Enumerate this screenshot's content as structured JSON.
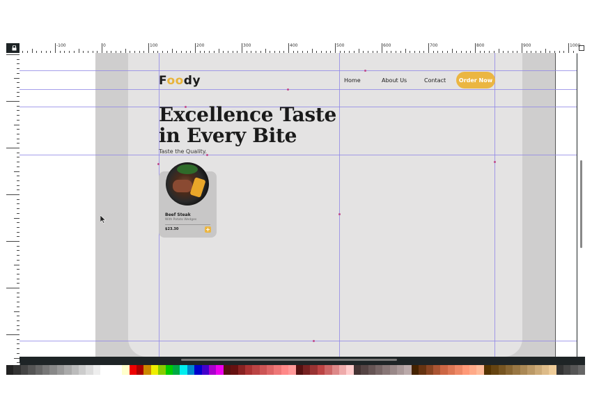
{
  "ruler": {
    "labels": [
      "-100",
      "0",
      "100",
      "200",
      "300",
      "400",
      "500",
      "600",
      "700",
      "800",
      "900",
      "1000"
    ]
  },
  "brand": {
    "logo_prefix": "F",
    "logo_oo": "oo",
    "logo_suffix": "dy"
  },
  "nav": {
    "items": [
      "Home",
      "About Us",
      "Contact"
    ],
    "cta": "Order Now"
  },
  "hero": {
    "line1": "Excellence Taste",
    "line2": "in Every Bite",
    "subtitle": "Taste the Quality."
  },
  "card": {
    "title": "Beef Steak",
    "subtitle": "With Potato Wedges",
    "price": "$23.30",
    "add_icon": "plus-icon"
  },
  "colors": {
    "accent": "#ebb642",
    "page": "#e4e3e3",
    "artboard": "#cfcece",
    "guide": "#8e86e6",
    "app_chrome": "#1e2426"
  },
  "palette": [
    "#222",
    "#333",
    "#444",
    "#555",
    "#666",
    "#777",
    "#888",
    "#999",
    "#aaa",
    "#bbb",
    "#ccc",
    "#ddd",
    "#eee",
    "#fff",
    "#fff",
    "#fff",
    "#ffc",
    "#e00",
    "#a00",
    "#c80",
    "#ee0",
    "#8c0",
    "#0c0",
    "#0a4",
    "#0ee",
    "#08c",
    "#00c",
    "#40c",
    "#a0c",
    "#e0e",
    "#511",
    "#611",
    "#822",
    "#a33",
    "#b44",
    "#c55",
    "#d66",
    "#e77",
    "#f88",
    "#f99",
    "#511",
    "#722",
    "#933",
    "#b44",
    "#c66",
    "#d88",
    "#eaa",
    "#fcc",
    "#433",
    "#544",
    "#655",
    "#766",
    "#877",
    "#988",
    "#a99",
    "#baa",
    "#420",
    "#631",
    "#842",
    "#a53",
    "#c64",
    "#d75",
    "#e86",
    "#f97",
    "#fa8",
    "#fb9",
    "#530",
    "#641",
    "#752",
    "#863",
    "#974",
    "#a85",
    "#b96",
    "#ca7",
    "#db8",
    "#ec9",
    "#333",
    "#444",
    "#555",
    "#666"
  ]
}
